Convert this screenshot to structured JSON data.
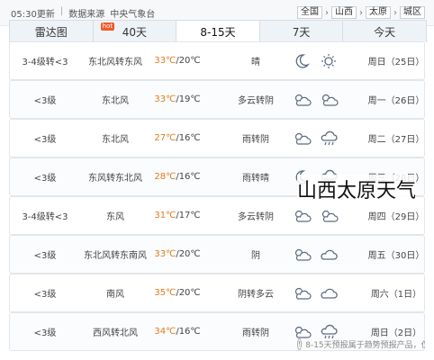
{
  "topbar": {
    "publish_time": "05:30更新",
    "source_label": "数据来源",
    "source_name": "中央气象台",
    "breadcrumb": [
      "全国",
      "山西",
      "太原",
      "城区"
    ]
  },
  "tabs": [
    {
      "label": "今天",
      "active": false
    },
    {
      "label": "7天",
      "active": false
    },
    {
      "label": "8-15天",
      "active": true
    },
    {
      "label": "40天",
      "active": false,
      "badge": "hot"
    },
    {
      "label": "雷达图",
      "active": false
    }
  ],
  "forecast": [
    {
      "day": "周日（25日）",
      "icon_day": "sun-icon",
      "icon_night": "moon-icon",
      "condition": "晴",
      "temp_high": "33℃",
      "temp_low": "20℃",
      "wind_dir": "东北风转东风",
      "wind_speed": "3-4级转<3"
    },
    {
      "day": "周一（26日）",
      "icon_day": "partly-cloudy-icon",
      "icon_night": "partly-cloudy-icon",
      "condition": "多云转阴",
      "temp_high": "33℃",
      "temp_low": "19℃",
      "wind_dir": "东北风",
      "wind_speed": "<3级"
    },
    {
      "day": "周二（27日）",
      "icon_day": "cloud-rain-icon",
      "icon_night": "partly-cloudy-icon",
      "condition": "雨转阴",
      "temp_high": "27℃",
      "temp_low": "16℃",
      "wind_dir": "东北风",
      "wind_speed": "<3级"
    },
    {
      "day": "周三（28日）",
      "icon_day": "cloud-rain-icon",
      "icon_night": "moon-icon",
      "condition": "雨转晴",
      "temp_high": "28℃",
      "temp_low": "16℃",
      "wind_dir": "东风转东北风",
      "wind_speed": "<3级"
    },
    {
      "day": "周四（29日）",
      "icon_day": "partly-cloudy-icon",
      "icon_night": "partly-cloudy-icon",
      "condition": "多云转阴",
      "temp_high": "31℃",
      "temp_low": "17℃",
      "wind_dir": "东风",
      "wind_speed": "3-4级转<3"
    },
    {
      "day": "周五（30日）",
      "icon_day": "cloud-icon",
      "icon_night": "partly-cloudy-icon",
      "condition": "阴",
      "temp_high": "33℃",
      "temp_low": "20℃",
      "wind_dir": "东北风转东南风",
      "wind_speed": "<3级"
    },
    {
      "day": "周六（1日）",
      "icon_day": "cloud-icon",
      "icon_night": "partly-cloudy-icon",
      "condition": "阴转多云",
      "temp_high": "35℃",
      "temp_low": "20℃",
      "wind_dir": "南风",
      "wind_speed": "<3级"
    },
    {
      "day": "周日（2日）",
      "icon_day": "cloud-rain-icon",
      "icon_night": "partly-cloudy-icon",
      "condition": "雨转阴",
      "temp_high": "34℃",
      "temp_low": "16℃",
      "wind_dir": "西风转北风",
      "wind_speed": "<3级"
    }
  ],
  "footer": {
    "note": "8-15天预报属于趋势预报产品，仅能反映未来天气变化趋势，请随时关注最新预报..."
  },
  "watermark": "山西太原天气",
  "colors": {
    "temp_high": "#e07b1a",
    "active_tab": "#ffffff",
    "tab_bar": "#eef3f8"
  }
}
